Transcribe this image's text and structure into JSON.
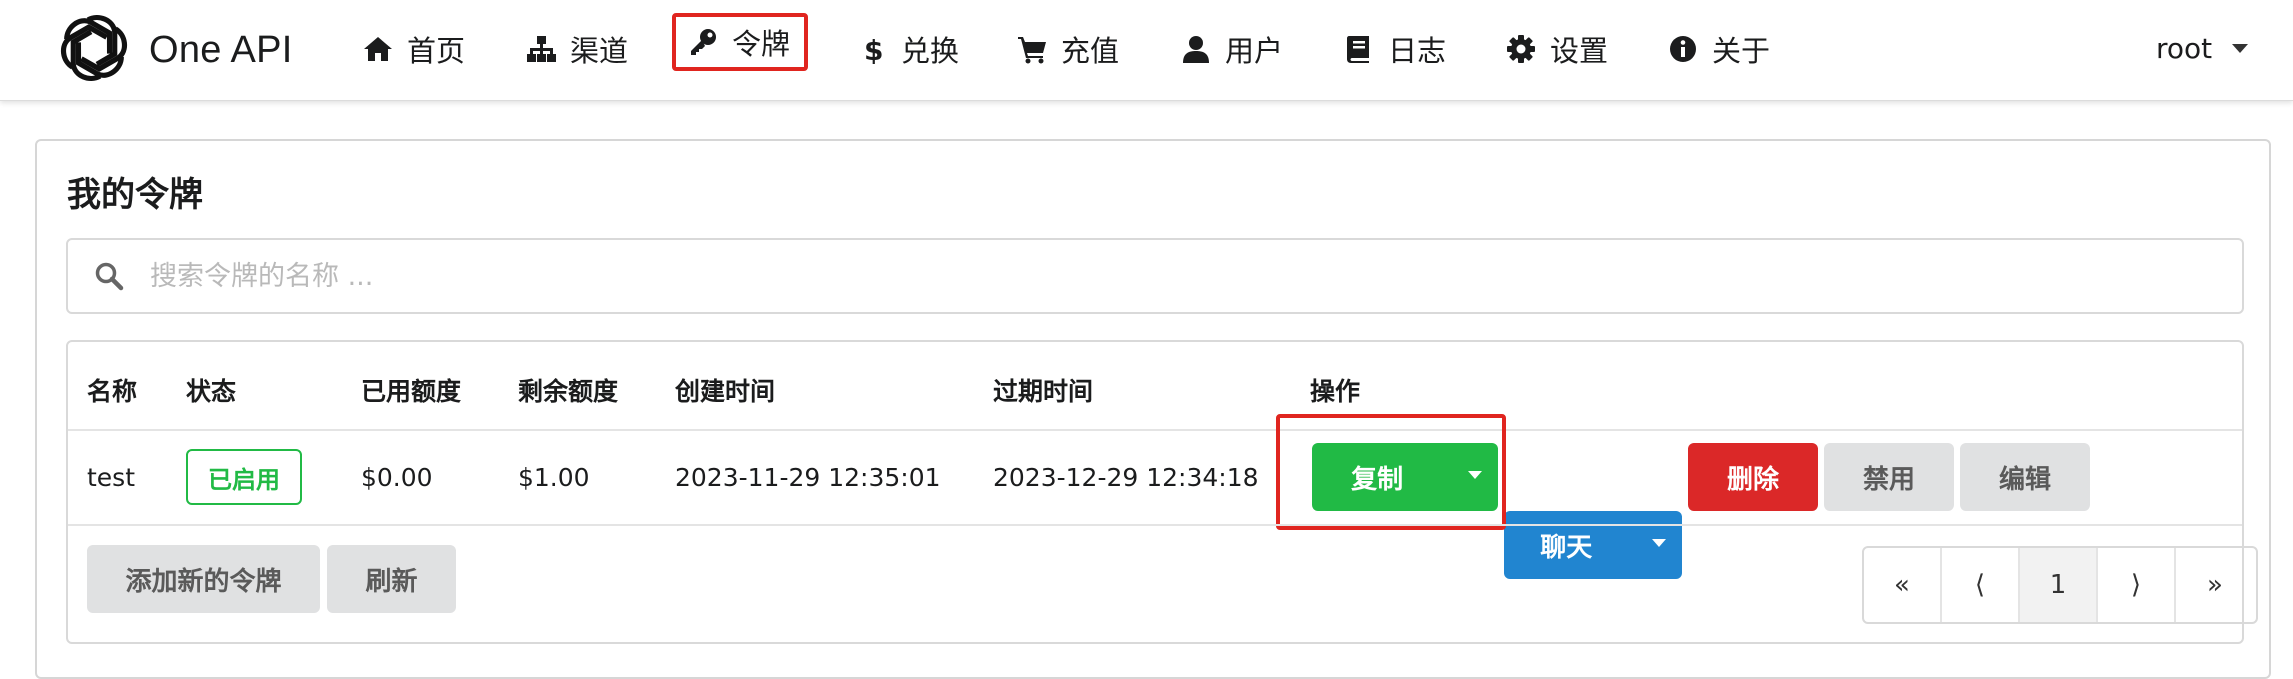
{
  "app": {
    "brand": "One API"
  },
  "nav": {
    "items": [
      {
        "label": "首页",
        "icon": "home-icon"
      },
      {
        "label": "渠道",
        "icon": "sitemap-icon"
      },
      {
        "label": "令牌",
        "icon": "key-icon",
        "active": true
      },
      {
        "label": "兑换",
        "icon": "dollar-icon"
      },
      {
        "label": "充值",
        "icon": "cart-icon"
      },
      {
        "label": "用户",
        "icon": "user-icon"
      },
      {
        "label": "日志",
        "icon": "book-icon"
      },
      {
        "label": "设置",
        "icon": "gear-icon"
      },
      {
        "label": "关于",
        "icon": "info-icon"
      }
    ],
    "user": "root"
  },
  "page": {
    "title": "我的令牌",
    "search_placeholder": "搜索令牌的名称 ..."
  },
  "table": {
    "headers": [
      "名称",
      "状态",
      "已用额度",
      "剩余额度",
      "创建时间",
      "过期时间",
      "操作"
    ],
    "rows": [
      {
        "name": "test",
        "status": "已启用",
        "used": "$0.00",
        "remaining": "$1.00",
        "created": "2023-11-29 12:35:01",
        "expires": "2023-12-29 12:34:18"
      }
    ],
    "actions": {
      "copy": "复制",
      "chat": "聊天",
      "delete": "删除",
      "disable": "禁用",
      "edit": "编辑"
    }
  },
  "footer": {
    "add_token": "添加新的令牌",
    "refresh": "刷新"
  },
  "pagination": {
    "first": "«",
    "prev": "⟨",
    "current": "1",
    "next": "⟩",
    "last": "»"
  },
  "colors": {
    "highlight": "#e0251f",
    "green": "#21ba45",
    "blue": "#2185d0",
    "red": "#db2828",
    "grey": "#e0e1e2"
  }
}
